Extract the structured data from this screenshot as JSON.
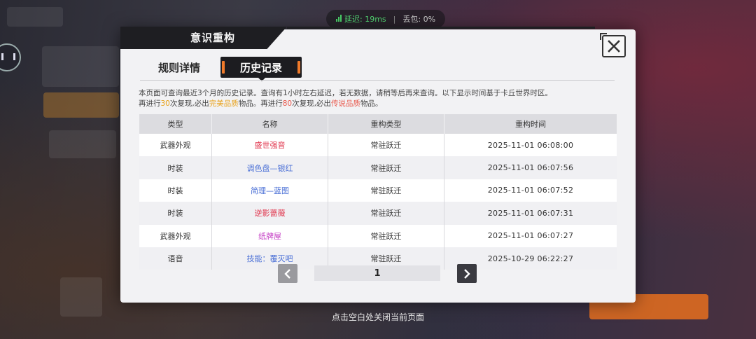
{
  "status_bar": {
    "latency": "延迟: 19ms",
    "packet_loss": "丢包: 0%",
    "separator": "|"
  },
  "modal": {
    "title": "意识重构",
    "tabs": [
      {
        "label": "规则详情",
        "active": false
      },
      {
        "label": "历史记录",
        "active": true
      }
    ],
    "notice": {
      "line1": "本页面可查询最近3个月的历史记录。查询有1小时左右延迟，若无数据，请稍等后再来查询。以下显示时间基于卡丘世界时区。",
      "line2_a": "再进行",
      "line2_n1": "30",
      "line2_b": "次复现,必出",
      "line2_q1": "完美品质",
      "line2_c": "物品。再进行",
      "line2_n2": "80",
      "line2_d": "次复现,必出",
      "line2_q2": "传说品质",
      "line2_e": "物品。"
    },
    "table": {
      "headers": [
        "类型",
        "名称",
        "重构类型",
        "重构时间"
      ],
      "rows": [
        {
          "type": "武器外观",
          "name": "盛世强音",
          "name_color": "#e0324a",
          "rtype": "常驻跃迁",
          "time": "2025-11-01   06:08:00"
        },
        {
          "type": "时装",
          "name": "调色盘—银红",
          "name_color": "#4a6fd6",
          "rtype": "常驻跃迁",
          "time": "2025-11-01   06:07:56"
        },
        {
          "type": "时装",
          "name": "简理—蓝图",
          "name_color": "#4a6fd6",
          "rtype": "常驻跃迁",
          "time": "2025-11-01   06:07:52"
        },
        {
          "type": "时装",
          "name": "逆影蔷薇",
          "name_color": "#e0324a",
          "rtype": "常驻跃迁",
          "time": "2025-11-01   06:07:31"
        },
        {
          "type": "武器外观",
          "name": "纸牌屋",
          "name_color": "#c43dc4",
          "rtype": "常驻跃迁",
          "time": "2025-11-01   06:07:27"
        },
        {
          "type": "语音",
          "name": "技能：覆灭吧",
          "name_color": "#4a6fd6",
          "rtype": "常驻跃迁",
          "time": "2025-10-29   06:22:27"
        }
      ]
    },
    "pagination": {
      "current_page": "1"
    }
  },
  "close_hint": "点击空白处关闭当前页面",
  "colors": {
    "accent_orange": "#f07a2a",
    "highlight_gold": "#e8a21a",
    "highlight_red": "#e8574a"
  }
}
